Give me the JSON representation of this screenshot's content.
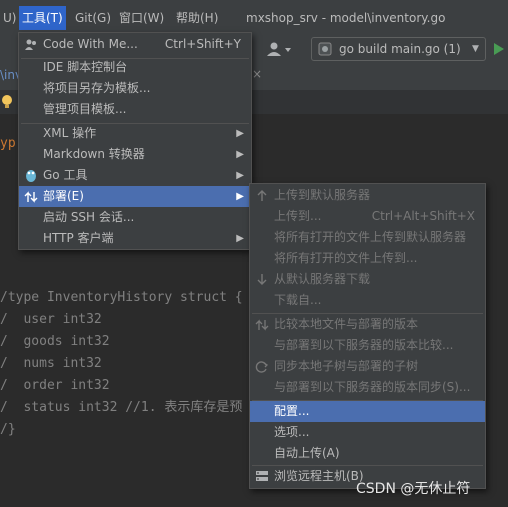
{
  "menubar": {
    "items": [
      "U)",
      "工具(T)",
      "Git(G)",
      "窗口(W)",
      "帮助(H)"
    ],
    "window_title": "mxshop_srv - model\\inventory.go"
  },
  "toolbar": {
    "user_icon": "user-icon",
    "run_config": "go build main.go (1)",
    "run_icon": "play-icon"
  },
  "tab_fragment": "\\inv",
  "editor": {
    "lines": [
      "yp",
      "/type InventoryHistory struct {",
      "/  user int32",
      "/  goods int32",
      "/  nums int32",
      "/  order int32",
      "/  status int32 //1. 表示库存是预",
      "/}"
    ]
  },
  "tools_menu": {
    "items": [
      {
        "label": "Code With Me...",
        "shortcut": "Ctrl+Shift+Y",
        "icon": "code-with-me-icon"
      },
      {
        "label": "IDE 脚本控制台"
      },
      {
        "label": "将项目另存为模板..."
      },
      {
        "label": "管理项目模板..."
      },
      {
        "label": "XML 操作"
      },
      {
        "label": "Markdown 转换器"
      },
      {
        "label": "Go 工具",
        "icon": "gopher-icon"
      },
      {
        "label": "部署(E)",
        "icon": "deployment-icon"
      },
      {
        "label": "启动 SSH 会话..."
      },
      {
        "label": "HTTP 客户端"
      }
    ]
  },
  "deploy_menu": {
    "items": [
      {
        "label": "上传到默认服务器",
        "icon": "upload-icon"
      },
      {
        "label": "上传到...",
        "shortcut": "Ctrl+Alt+Shift+X"
      },
      {
        "label": "将所有打开的文件上传到默认服务器"
      },
      {
        "label": "将所有打开的文件上传到..."
      },
      {
        "label": "从默认服务器下载",
        "icon": "download-icon"
      },
      {
        "label": "下载自..."
      },
      {
        "label": "比较本地文件与部署的版本",
        "icon": "compare-icon"
      },
      {
        "label": "与部署到以下服务器的版本比较..."
      },
      {
        "label": "同步本地子树与部署的子树",
        "icon": "sync-icon"
      },
      {
        "label": "与部署到以下服务器的版本同步(S)..."
      },
      {
        "label": "配置..."
      },
      {
        "label": "选项..."
      },
      {
        "label": "自动上传(A)"
      },
      {
        "label": "浏览远程主机(B)",
        "icon": "remote-host-icon"
      }
    ]
  },
  "watermark": "CSDN @无休止符"
}
